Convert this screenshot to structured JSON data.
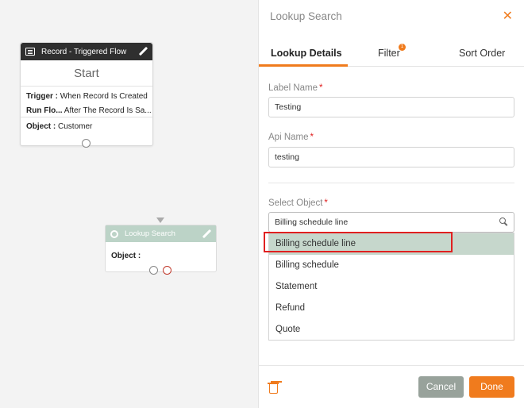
{
  "canvas": {
    "start_node": {
      "header": "Record - Triggered Flow",
      "title": "Start",
      "trigger_label": "Trigger :",
      "trigger_value": "When Record Is Created",
      "run_label": "Run Flo...",
      "run_value": "After The Record Is Sa...",
      "object_label": "Object :",
      "object_value": "Customer"
    },
    "lookup_node": {
      "header": "Lookup Search",
      "object_label": "Object :"
    }
  },
  "panel": {
    "title": "Lookup Search",
    "close_glyph": "✕",
    "tabs": [
      {
        "label": "Lookup Details"
      },
      {
        "label": "Filter"
      },
      {
        "label": "Sort Order"
      }
    ],
    "filter_badge": "1",
    "label_name": {
      "label": "Label Name",
      "required": "*",
      "value": "Testing"
    },
    "api_name": {
      "label": "Api Name",
      "required": "*",
      "value": "testing"
    },
    "select_object": {
      "label": "Select Object",
      "required": "*",
      "value": "Billing schedule line"
    },
    "options": [
      "Billing schedule line",
      "Billing schedule",
      "Statement",
      "Refund",
      "Quote"
    ],
    "buttons": {
      "cancel": "Cancel",
      "done": "Done"
    }
  },
  "colors": {
    "accent": "#f07b1d",
    "selected_option": "#c6d7cc",
    "highlight": "#e02020"
  }
}
